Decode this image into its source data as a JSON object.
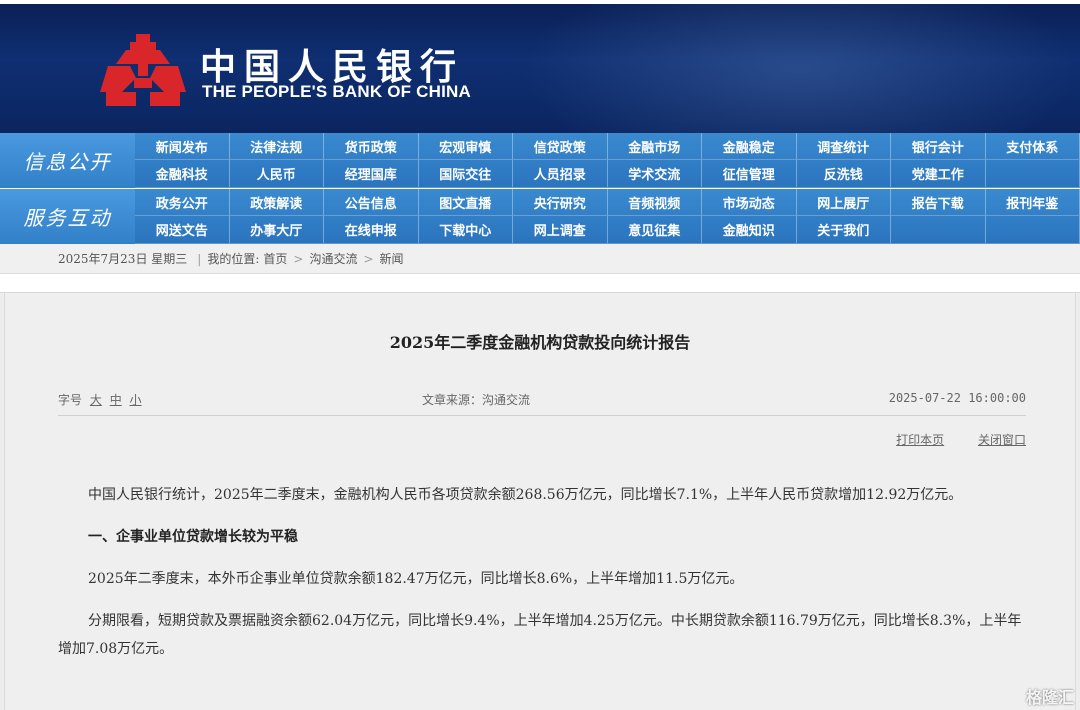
{
  "header": {
    "cn_name": "中国人民银行",
    "en_name": "THE PEOPLE'S BANK OF CHINA",
    "logo_color": "#d8262a"
  },
  "nav": {
    "section1_title": "信息公开",
    "section2_title": "服务互动",
    "row1": [
      "新闻发布",
      "法律法规",
      "货币政策",
      "宏观审慎",
      "信贷政策",
      "金融市场",
      "金融稳定",
      "调查统计",
      "银行会计",
      "支付体系"
    ],
    "row2": [
      "金融科技",
      "人民币",
      "经理国库",
      "国际交往",
      "人员招录",
      "学术交流",
      "征信管理",
      "反洗钱",
      "党建工作",
      ""
    ],
    "row3": [
      "政务公开",
      "政策解读",
      "公告信息",
      "图文直播",
      "央行研究",
      "音频视频",
      "市场动态",
      "网上展厅",
      "报告下载",
      "报刊年鉴"
    ],
    "row4": [
      "网送文告",
      "办事大厅",
      "在线申报",
      "下载中心",
      "网上调查",
      "意见征集",
      "金融知识",
      "关于我们",
      "",
      ""
    ]
  },
  "breadcrumb": {
    "date": "2025年7月23日 星期三",
    "location_label": "我的位置:",
    "home": "首页",
    "level1": "沟通交流",
    "level2": "新闻"
  },
  "article": {
    "title": "2025年二季度金融机构贷款投向统计报告",
    "font_label": "字号",
    "font_large": "大",
    "font_medium": "中",
    "font_small": "小",
    "source": "文章来源：沟通交流",
    "datetime": "2025-07-22 16:00:00",
    "print": "打印本页",
    "close": "关闭窗口",
    "para1": "中国人民银行统计，2025年二季度末，金融机构人民币各项贷款余额268.56万亿元，同比增长7.1%，上半年人民币贷款增加12.92万亿元。",
    "heading1": "一、企事业单位贷款增长较为平稳",
    "para2": "2025年二季度末，本外币企事业单位贷款余额182.47万亿元，同比增长8.6%，上半年增加11.5万亿元。",
    "para3": "分期限看，短期贷款及票据融资余额62.04万亿元，同比增长9.4%，上半年增加4.25万亿元。中长期贷款余额116.79万亿元，同比增长8.3%，上半年增加7.08万亿元。"
  },
  "watermark": "格隆汇"
}
